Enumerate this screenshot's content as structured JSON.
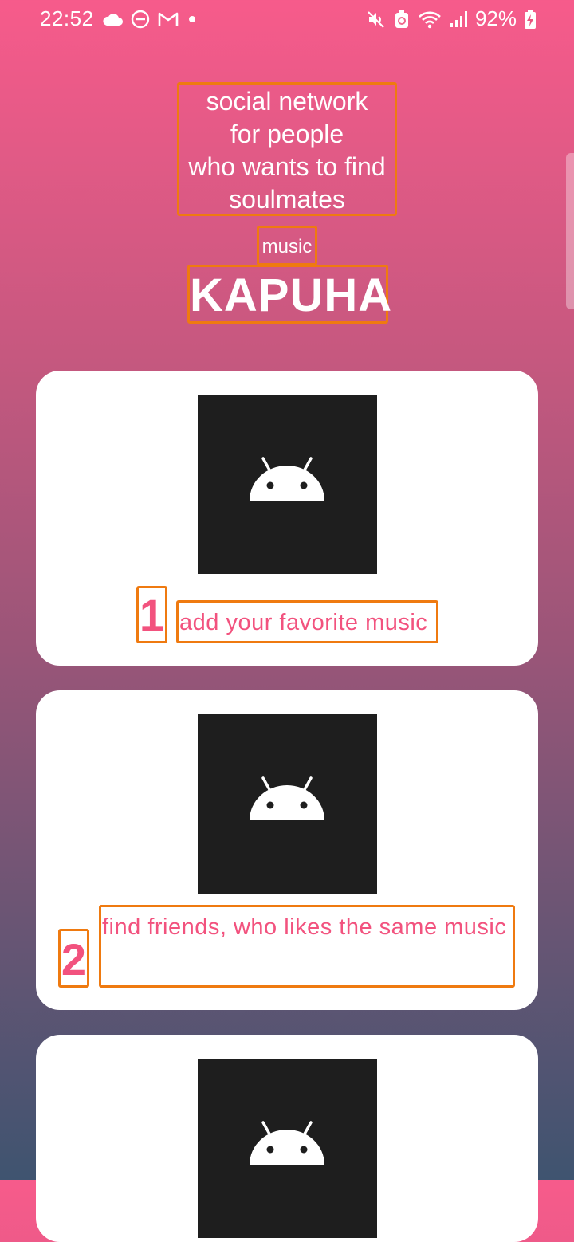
{
  "status_bar": {
    "time": "22:52",
    "battery": "92%",
    "icons_left": [
      "cloud-icon",
      "do-not-disturb-icon",
      "gmail-icon",
      "dot-icon"
    ],
    "icons_right": [
      "mute-icon",
      "battery-saver-icon",
      "wifi-icon",
      "signal-icon",
      "battery-charging-icon"
    ]
  },
  "header": {
    "tagline": "social network\nfor people\nwho wants to find\nsoulmates",
    "music_label": "music",
    "app_title": "KAPUHA"
  },
  "cards": [
    {
      "number": "1",
      "text": "add your favorite music",
      "image_icon": "android-icon"
    },
    {
      "number": "2",
      "text": "find friends, who likes the same music",
      "image_icon": "android-icon"
    },
    {
      "image_icon": "android-icon"
    }
  ],
  "colors": {
    "accent": "#f2527e",
    "outline": "#ef7a10",
    "gradient_top": "#f75b8b",
    "gradient_bottom": "#3f5470",
    "image_bg": "#1e1e1e"
  }
}
